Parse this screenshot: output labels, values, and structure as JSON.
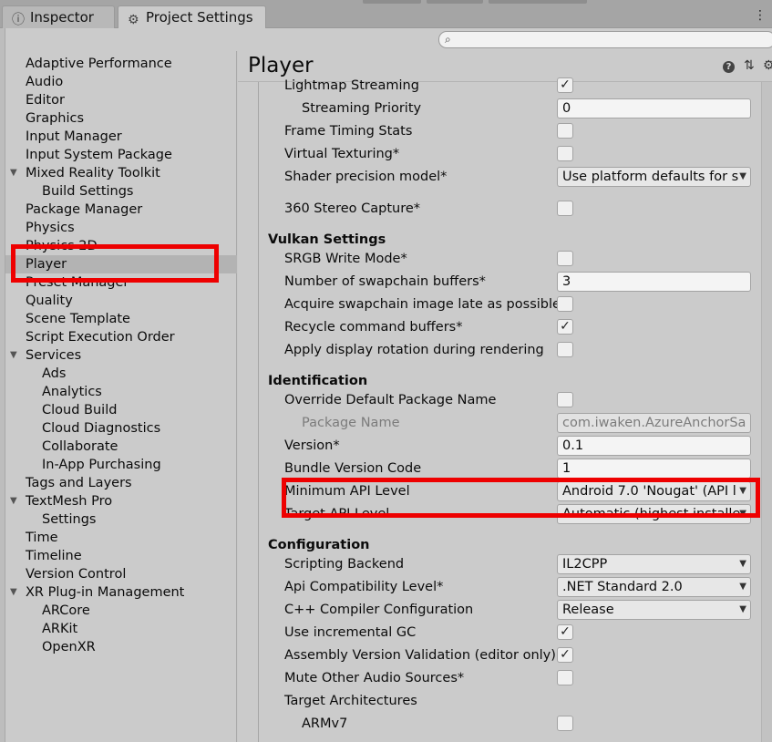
{
  "tabs": {
    "inspector": {
      "label": "Inspector",
      "icon": "info-icon"
    },
    "project_settings": {
      "label": "Project Settings",
      "icon": "gear-icon"
    }
  },
  "search": {
    "placeholder": ""
  },
  "sidebar": {
    "items": [
      {
        "label": "Adaptive Performance",
        "indent": 0,
        "arrow": ""
      },
      {
        "label": "Audio",
        "indent": 0,
        "arrow": ""
      },
      {
        "label": "Editor",
        "indent": 0,
        "arrow": ""
      },
      {
        "label": "Graphics",
        "indent": 0,
        "arrow": ""
      },
      {
        "label": "Input Manager",
        "indent": 0,
        "arrow": ""
      },
      {
        "label": "Input System Package",
        "indent": 0,
        "arrow": ""
      },
      {
        "label": "Mixed Reality Toolkit",
        "indent": 0,
        "arrow": "▼"
      },
      {
        "label": "Build Settings",
        "indent": 1,
        "arrow": ""
      },
      {
        "label": "Package Manager",
        "indent": 0,
        "arrow": ""
      },
      {
        "label": "Physics",
        "indent": 0,
        "arrow": ""
      },
      {
        "label": "Physics 2D",
        "indent": 0,
        "arrow": ""
      },
      {
        "label": "Player",
        "indent": 0,
        "arrow": "",
        "selected": true
      },
      {
        "label": "Preset Manager",
        "indent": 0,
        "arrow": ""
      },
      {
        "label": "Quality",
        "indent": 0,
        "arrow": ""
      },
      {
        "label": "Scene Template",
        "indent": 0,
        "arrow": ""
      },
      {
        "label": "Script Execution Order",
        "indent": 0,
        "arrow": ""
      },
      {
        "label": "Services",
        "indent": 0,
        "arrow": "▼"
      },
      {
        "label": "Ads",
        "indent": 1,
        "arrow": ""
      },
      {
        "label": "Analytics",
        "indent": 1,
        "arrow": ""
      },
      {
        "label": "Cloud Build",
        "indent": 1,
        "arrow": ""
      },
      {
        "label": "Cloud Diagnostics",
        "indent": 1,
        "arrow": ""
      },
      {
        "label": "Collaborate",
        "indent": 1,
        "arrow": ""
      },
      {
        "label": "In-App Purchasing",
        "indent": 1,
        "arrow": ""
      },
      {
        "label": "Tags and Layers",
        "indent": 0,
        "arrow": ""
      },
      {
        "label": "TextMesh Pro",
        "indent": 0,
        "arrow": "▼"
      },
      {
        "label": "Settings",
        "indent": 1,
        "arrow": ""
      },
      {
        "label": "Time",
        "indent": 0,
        "arrow": ""
      },
      {
        "label": "Timeline",
        "indent": 0,
        "arrow": ""
      },
      {
        "label": "Version Control",
        "indent": 0,
        "arrow": ""
      },
      {
        "label": "XR Plug-in Management",
        "indent": 0,
        "arrow": "▼"
      },
      {
        "label": "ARCore",
        "indent": 1,
        "arrow": ""
      },
      {
        "label": "ARKit",
        "indent": 1,
        "arrow": ""
      },
      {
        "label": "OpenXR",
        "indent": 1,
        "arrow": ""
      }
    ]
  },
  "main": {
    "title": "Player",
    "rows": [
      {
        "type": "field",
        "label": "Lightmap Streaming",
        "control": "checkbox",
        "checked": true,
        "indent": 0
      },
      {
        "type": "field",
        "label": "Streaming Priority",
        "control": "text",
        "value": "0",
        "indent": 1
      },
      {
        "type": "field",
        "label": "Frame Timing Stats",
        "control": "checkbox",
        "checked": false,
        "indent": 0
      },
      {
        "type": "field",
        "label": "Virtual Texturing*",
        "control": "checkbox",
        "checked": false,
        "indent": 0
      },
      {
        "type": "field",
        "label": "Shader precision model*",
        "control": "dropdown",
        "value": "Use platform defaults for s",
        "indent": 0
      },
      {
        "type": "field",
        "label": "360 Stereo Capture*",
        "control": "checkbox",
        "checked": false,
        "indent": 0,
        "gap": 10
      },
      {
        "type": "section",
        "label": "Vulkan Settings"
      },
      {
        "type": "field",
        "label": "SRGB Write Mode*",
        "control": "checkbox",
        "checked": false,
        "indent": 0
      },
      {
        "type": "field",
        "label": "Number of swapchain buffers*",
        "control": "text",
        "value": "3",
        "indent": 0
      },
      {
        "type": "field",
        "label": "Acquire swapchain image late as possible",
        "control": "checkbox",
        "checked": false,
        "indent": 0
      },
      {
        "type": "field",
        "label": "Recycle command buffers*",
        "control": "checkbox",
        "checked": true,
        "indent": 0
      },
      {
        "type": "field",
        "label": "Apply display rotation during rendering",
        "control": "checkbox",
        "checked": false,
        "indent": 0
      },
      {
        "type": "section",
        "label": "Identification"
      },
      {
        "type": "field",
        "label": "Override Default Package Name",
        "control": "checkbox",
        "checked": false,
        "indent": 0
      },
      {
        "type": "field",
        "label": "Package Name",
        "control": "text",
        "value": "com.iwaken.AzureAnchorSa",
        "indent": 1,
        "disabled": true
      },
      {
        "type": "field",
        "label": "Version*",
        "control": "text",
        "value": "0.1",
        "indent": 0
      },
      {
        "type": "field",
        "label": "Bundle Version Code",
        "control": "text",
        "value": "1",
        "indent": 0
      },
      {
        "type": "field",
        "label": "Minimum API Level",
        "control": "dropdown",
        "value": "Android 7.0 'Nougat' (API l",
        "indent": 0
      },
      {
        "type": "field",
        "label": "Target API Level",
        "control": "dropdown",
        "value": "Automatic (highest installe",
        "indent": 0
      },
      {
        "type": "section",
        "label": "Configuration"
      },
      {
        "type": "field",
        "label": "Scripting Backend",
        "control": "dropdown",
        "value": "IL2CPP",
        "indent": 0
      },
      {
        "type": "field",
        "label": "Api Compatibility Level*",
        "control": "dropdown",
        "value": ".NET Standard 2.0",
        "indent": 0
      },
      {
        "type": "field",
        "label": "C++ Compiler Configuration",
        "control": "dropdown",
        "value": "Release",
        "indent": 0
      },
      {
        "type": "field",
        "label": "Use incremental GC",
        "control": "checkbox",
        "checked": true,
        "indent": 0
      },
      {
        "type": "field",
        "label": "Assembly Version Validation (editor only)",
        "control": "checkbox",
        "checked": true,
        "indent": 0
      },
      {
        "type": "field",
        "label": "Mute Other Audio Sources*",
        "control": "checkbox",
        "checked": false,
        "indent": 0
      },
      {
        "type": "field",
        "label": "Target Architectures",
        "control": "none",
        "indent": 0
      },
      {
        "type": "field",
        "label": "ARMv7",
        "control": "checkbox",
        "checked": false,
        "indent": 1
      }
    ]
  },
  "colors": {
    "highlight": "#ee0000",
    "panel": "#cbcbcb",
    "tabbar": "#a5a5a5"
  }
}
